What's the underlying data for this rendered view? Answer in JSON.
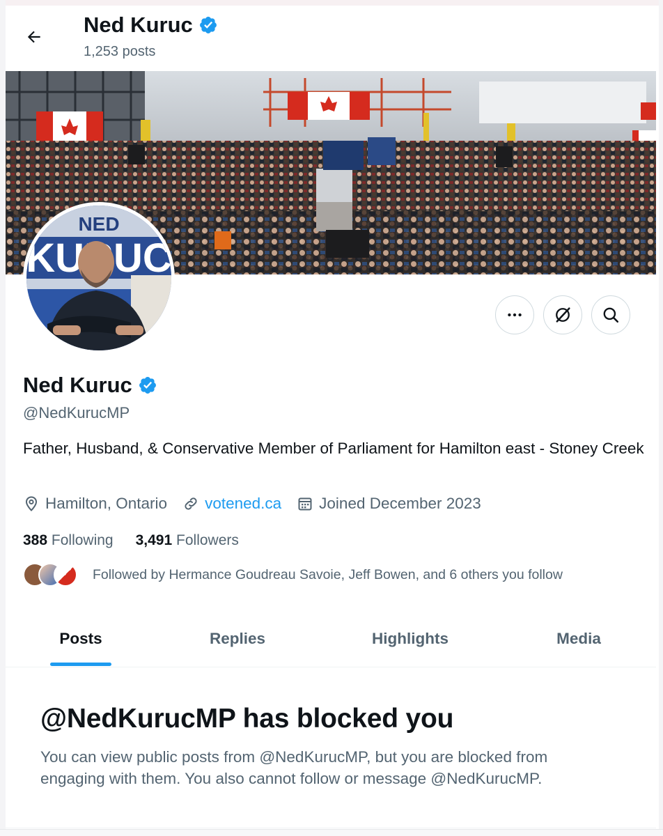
{
  "header": {
    "name": "Ned Kuruc",
    "posts_count": "1,253 posts"
  },
  "profile": {
    "name": "Ned Kuruc",
    "handle": "@NedKurucMP",
    "bio": "Father, Husband, & Conservative Member of Parliament for Hamilton east - Stoney Creek",
    "location": "Hamilton, Ontario",
    "website": "votened.ca",
    "joined": "Joined December 2023",
    "following_count": "388",
    "following_label": "Following",
    "followers_count": "3,491",
    "followers_label": "Followers",
    "followed_by": "Followed by Hermance Goudreau Savoie, Jeff Bowen, and 6 others you follow",
    "avatar_sign_top": "NED",
    "avatar_sign_main": "KURUC"
  },
  "actions": {
    "more_icon": "more-icon",
    "grok_icon": "grok-icon",
    "search_icon": "search-icon"
  },
  "tabs": [
    {
      "label": "Posts",
      "active": true
    },
    {
      "label": "Replies",
      "active": false
    },
    {
      "label": "Highlights",
      "active": false
    },
    {
      "label": "Media",
      "active": false
    }
  ],
  "blocked": {
    "title": "@NedKurucMP has blocked you",
    "message": "You can view public posts from @NedKurucMP, but you are blocked from engaging with them. You also cannot follow or message @NedKurucMP."
  },
  "colors": {
    "accent": "#1d9bf0",
    "secondary_text": "#536471",
    "primary_text": "#0f1419",
    "verified": "#1d9bf0"
  }
}
